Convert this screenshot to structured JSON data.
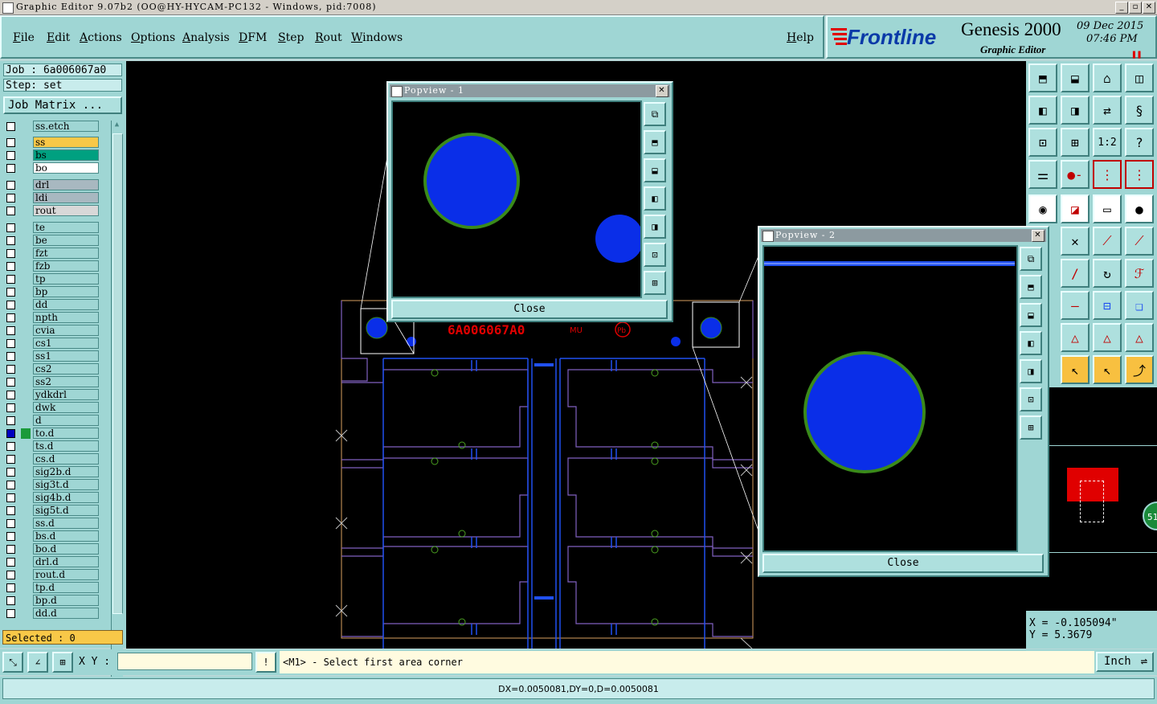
{
  "window": {
    "title": "Graphic Editor 9.07b2 (OO@HY-HYCAM-PC132 - Windows, pid:7008)",
    "min_label": "_",
    "max_label": "▫",
    "close_label": "✕"
  },
  "menu": {
    "items": [
      "File",
      "Edit",
      "Actions",
      "Options",
      "Analysis",
      "DFM",
      "Step",
      "Rout",
      "Windows"
    ],
    "help": "Help"
  },
  "brand": {
    "logo": "Frontline",
    "product": "Genesis 2000",
    "subtitle": "Graphic Editor",
    "date": "09 Dec 2015",
    "time": "07:46 PM"
  },
  "left": {
    "job": "Job : 6a006067a0",
    "step": "Step: set",
    "job_matrix": "Job Matrix ...",
    "selected": "Selected : 0",
    "layers": [
      {
        "name": "ss.etch",
        "color": "#9fd6d4"
      },
      {
        "name": "ss",
        "color": "#f8c848"
      },
      {
        "name": "bs",
        "color": "#00a080"
      },
      {
        "name": "bo",
        "color": "#ffffff"
      },
      {
        "name": "drl",
        "color": "#a8b8c0"
      },
      {
        "name": "ldi",
        "color": "#a8b8c0"
      },
      {
        "name": "rout",
        "color": "#d8d8d8"
      },
      {
        "name": "te",
        "color": "#9fd6d4"
      },
      {
        "name": "be",
        "color": "#9fd6d4"
      },
      {
        "name": "fzt",
        "color": "#9fd6d4"
      },
      {
        "name": "fzb",
        "color": "#9fd6d4"
      },
      {
        "name": "tp",
        "color": "#9fd6d4"
      },
      {
        "name": "bp",
        "color": "#9fd6d4"
      },
      {
        "name": "dd",
        "color": "#9fd6d4"
      },
      {
        "name": "npth",
        "color": "#9fd6d4"
      },
      {
        "name": "cvia",
        "color": "#9fd6d4"
      },
      {
        "name": "cs1",
        "color": "#9fd6d4"
      },
      {
        "name": "ss1",
        "color": "#9fd6d4"
      },
      {
        "name": "cs2",
        "color": "#9fd6d4"
      },
      {
        "name": "ss2",
        "color": "#9fd6d4"
      },
      {
        "name": "ydkdrl",
        "color": "#9fd6d4"
      },
      {
        "name": "dwk",
        "color": "#9fd6d4"
      },
      {
        "name": "d",
        "color": "#9fd6d4"
      },
      {
        "name": "to.d",
        "color": "#9fd6d4"
      },
      {
        "name": "ts.d",
        "color": "#9fd6d4"
      },
      {
        "name": "cs.d",
        "color": "#9fd6d4"
      },
      {
        "name": "sig2b.d",
        "color": "#9fd6d4"
      },
      {
        "name": "sig3t.d",
        "color": "#9fd6d4"
      },
      {
        "name": "sig4b.d",
        "color": "#9fd6d4"
      },
      {
        "name": "sig5t.d",
        "color": "#9fd6d4"
      },
      {
        "name": "ss.d",
        "color": "#9fd6d4"
      },
      {
        "name": "bs.d",
        "color": "#9fd6d4"
      },
      {
        "name": "bo.d",
        "color": "#9fd6d4"
      },
      {
        "name": "drl.d",
        "color": "#9fd6d4"
      },
      {
        "name": "rout.d",
        "color": "#9fd6d4"
      },
      {
        "name": "tp.d",
        "color": "#9fd6d4"
      },
      {
        "name": "bp.d",
        "color": "#9fd6d4"
      },
      {
        "name": "dd.d",
        "color": "#9fd6d4"
      }
    ]
  },
  "canvas": {
    "board_text": "6A006067A0",
    "marking_text": "MU",
    "pb_text": "Pb"
  },
  "popview1": {
    "title": "Popview - 1",
    "close": "Close"
  },
  "popview2": {
    "title": "Popview - 2",
    "close": "Close"
  },
  "coords": {
    "x": "X = -0.105094\"",
    "y": "Y = 5.3679"
  },
  "right_misc": {
    "badge": "51"
  },
  "status": {
    "xy_label": "X Y :",
    "xy_value": "",
    "message": "<M1> - Select first area corner",
    "unit": "Inch",
    "measure": "DX=0.0050081,DY=0,D=0.0050081"
  },
  "colors": {
    "accent": "#9fd6d4",
    "canvas_bg": "#000000",
    "pad_blue": "#0a2ee8",
    "pad_ring": "#3a8a1a",
    "board_red": "#e00000",
    "outline_purple": "#8060c0"
  }
}
